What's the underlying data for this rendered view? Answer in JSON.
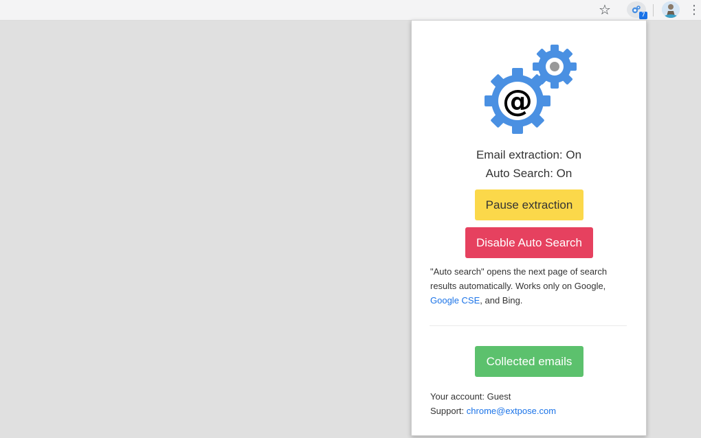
{
  "browser": {
    "bookmark_icon": "star-outline-icon",
    "extension_badge": "7",
    "extension_icon": "gears-at-icon",
    "avatar_icon": "profile-avatar-icon",
    "menu_icon": "kebab-menu-icon",
    "menu_glyph": "⋮",
    "star_glyph": "☆"
  },
  "popup": {
    "logo_icon": "email-gears-logo",
    "status_email": "Email extraction: On",
    "status_auto": "Auto Search: On",
    "pause_button": "Pause extraction",
    "disable_button": "Disable Auto Search",
    "description": {
      "text_before": "\"Auto search\" opens the next page of search results automatically. Works only on Google,",
      "link_text": "Google CSE",
      "text_after": ", and Bing."
    },
    "collected_button": "Collected emails",
    "account": "Your account: Guest",
    "support_label": "Support:",
    "support_email": "chrome@extpose.com"
  },
  "colors": {
    "pause": "#fbd84a",
    "disable": "#e6415f",
    "collected": "#5cc16d",
    "link": "#1a73e8",
    "gear_blue": "#4a90e2"
  }
}
